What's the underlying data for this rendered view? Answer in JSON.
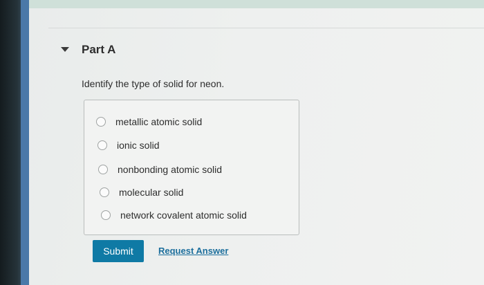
{
  "part": {
    "title": "Part A",
    "question": "Identify the type of solid for neon."
  },
  "options": [
    {
      "label": "metallic atomic solid",
      "selected": false
    },
    {
      "label": "ionic solid",
      "selected": false
    },
    {
      "label": "nonbonding atomic solid",
      "selected": false
    },
    {
      "label": "molecular solid",
      "selected": false
    },
    {
      "label": "network covalent atomic solid",
      "selected": false
    }
  ],
  "actions": {
    "submit_label": "Submit",
    "request_answer_label": "Request Answer"
  },
  "icons": {
    "collapse": "caret-down-icon"
  },
  "colors": {
    "submit_button": "#0f7aa5",
    "link": "#1b6e9c",
    "text": "#2d2d2d"
  }
}
